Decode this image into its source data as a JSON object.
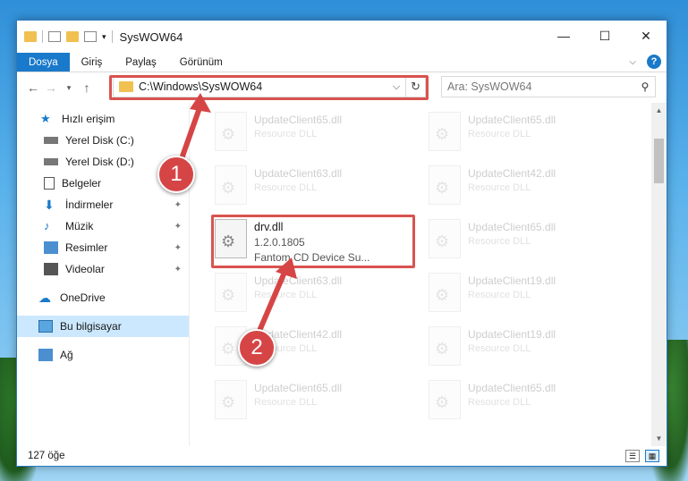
{
  "window": {
    "title": "SysWOW64",
    "caption": {
      "minimize": "—",
      "maximize": "☐",
      "close": "✕"
    }
  },
  "ribbon": {
    "tabs": [
      "Dosya",
      "Giriş",
      "Paylaş",
      "Görünüm"
    ]
  },
  "navbar": {
    "address": "C:\\Windows\\SysWOW64",
    "search_placeholder": "Ara: SysWOW64"
  },
  "sidebar": {
    "items": [
      {
        "label": "Hızlı erişim",
        "icon": "star-icon"
      },
      {
        "label": "Yerel Disk (C:)",
        "icon": "drive-icon"
      },
      {
        "label": "Yerel Disk (D:)",
        "icon": "drive-icon"
      },
      {
        "label": "Belgeler",
        "icon": "document-icon"
      },
      {
        "label": "İndirmeler",
        "icon": "download-icon",
        "pinned": true
      },
      {
        "label": "Müzik",
        "icon": "music-icon",
        "pinned": true
      },
      {
        "label": "Resimler",
        "icon": "pictures-icon",
        "pinned": true
      },
      {
        "label": "Videolar",
        "icon": "video-icon",
        "pinned": true
      },
      {
        "label": "OneDrive",
        "icon": "cloud-icon"
      },
      {
        "label": "Bu bilgisayar",
        "icon": "computer-icon",
        "selected": true
      },
      {
        "label": "Ağ",
        "icon": "network-icon"
      }
    ]
  },
  "files": {
    "col1": [
      {
        "name": "UpdateClient65.dll",
        "sub": "Resource DLL"
      },
      {
        "name": "UpdateClient63.dll",
        "sub": "Resource DLL"
      },
      {
        "name": "drv.dll",
        "sub": "1.2.0.1805",
        "sub2": "Fantom CD Device Su..."
      },
      {
        "name": "UpdateClient63.dll",
        "sub": "Resource DLL"
      },
      {
        "name": "UpdateClient42.dll",
        "sub": "Resource DLL"
      },
      {
        "name": "UpdateClient65.dll",
        "sub": "Resource DLL"
      }
    ],
    "col2": [
      {
        "name": "UpdateClient65.dll",
        "sub": "Resource DLL"
      },
      {
        "name": "UpdateClient42.dll",
        "sub": "Resource DLL"
      },
      {
        "name": "UpdateClient65.dll",
        "sub": "Resource DLL"
      },
      {
        "name": "UpdateClient19.dll",
        "sub": "Resource DLL"
      },
      {
        "name": "UpdateClient19.dll",
        "sub": "Resource DLL"
      },
      {
        "name": "UpdateClient65.dll",
        "sub": "Resource DLL"
      }
    ]
  },
  "status": {
    "count": "127 öğe"
  },
  "annotations": {
    "badge1": "1",
    "badge2": "2"
  },
  "colors": {
    "accent": "#1979ca",
    "annotation": "#d64545"
  }
}
